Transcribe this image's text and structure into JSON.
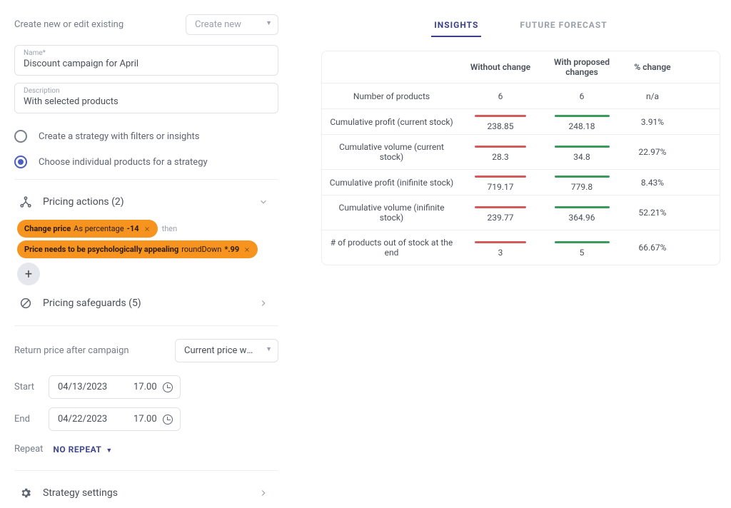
{
  "header": {
    "title": "Create new or edit existing",
    "createNew": "Create new"
  },
  "fields": {
    "nameLabel": "Name*",
    "nameValue": "Discount campaign for April",
    "descLabel": "Description",
    "descValue": "With selected products"
  },
  "strategy": {
    "option1": "Create a strategy with filters or insights",
    "option2": "Choose individual products for a strategy"
  },
  "pricingActions": {
    "title": "Pricing actions (2)",
    "chip1": {
      "prefix": "Change price",
      "mid": "As percentage",
      "val": "-14"
    },
    "then": "then",
    "chip2": {
      "prefix": "Price needs to be psychologically appealing",
      "mid": "roundDown",
      "val": "*.99"
    }
  },
  "safeguards": {
    "title": "Pricing safeguards (5)"
  },
  "returnPrice": {
    "label": "Return price after campaign",
    "value": "Current price when c…"
  },
  "start": {
    "label": "Start",
    "date": "04/13/2023",
    "time": "17.00"
  },
  "end": {
    "label": "End",
    "date": "04/22/2023",
    "time": "17.00"
  },
  "repeat": {
    "label": "Repeat",
    "value": "NO REPEAT"
  },
  "settings": {
    "title": "Strategy settings"
  },
  "tabs": {
    "insights": "INSIGHTS",
    "forecast": "FUTURE FORECAST"
  },
  "table": {
    "headers": {
      "a": "Without change",
      "b": "With proposed changes",
      "c": "% change"
    },
    "rows": [
      {
        "label": "Number of products",
        "a": "6",
        "b": "6",
        "c": "n/a",
        "bars": false
      },
      {
        "label": "Cumulative profit (current stock)",
        "a": "238.85",
        "b": "248.18",
        "c": "3.91%",
        "bars": true
      },
      {
        "label": "Cumulative volume (current stock)",
        "a": "28.3",
        "b": "34.8",
        "c": "22.97%",
        "bars": true
      },
      {
        "label": "Cumulative profit (inifinite stock)",
        "a": "719.17",
        "b": "779.8",
        "c": "8.43%",
        "bars": true
      },
      {
        "label": "Cumulative volume (inifinite stock)",
        "a": "239.77",
        "b": "364.96",
        "c": "52.21%",
        "bars": true
      },
      {
        "label": "# of products out of stock at the end",
        "a": "3",
        "b": "5",
        "c": "66.67%",
        "bars": true
      }
    ]
  }
}
